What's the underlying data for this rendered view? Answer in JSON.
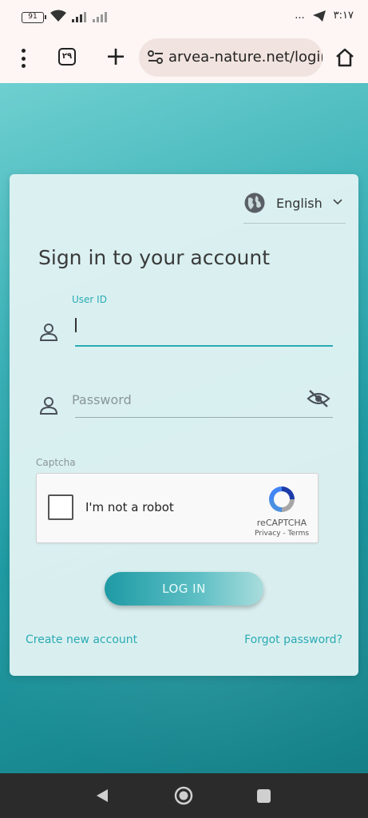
{
  "status_bar": {
    "battery": "91",
    "time": "۳:۱۷",
    "more": "..."
  },
  "browser": {
    "tab_count": "۲۹",
    "url": "arvea-nature.net/login",
    "plus": "+"
  },
  "login": {
    "language": "English",
    "title": "Sign in to your account",
    "user_id_label": "User ID",
    "password_placeholder": "Password",
    "captcha_label": "Captcha",
    "not_robot": "I'm not a robot",
    "recaptcha_brand": "reCAPTCHA",
    "recaptcha_links": "Privacy - Terms",
    "login_button": "LOG IN",
    "create_account": "Create new account",
    "forgot_password": "Forgot password?"
  },
  "colors": {
    "accent": "#2aaab4",
    "background": "#1f8f96",
    "card": "#e1f3f3"
  }
}
